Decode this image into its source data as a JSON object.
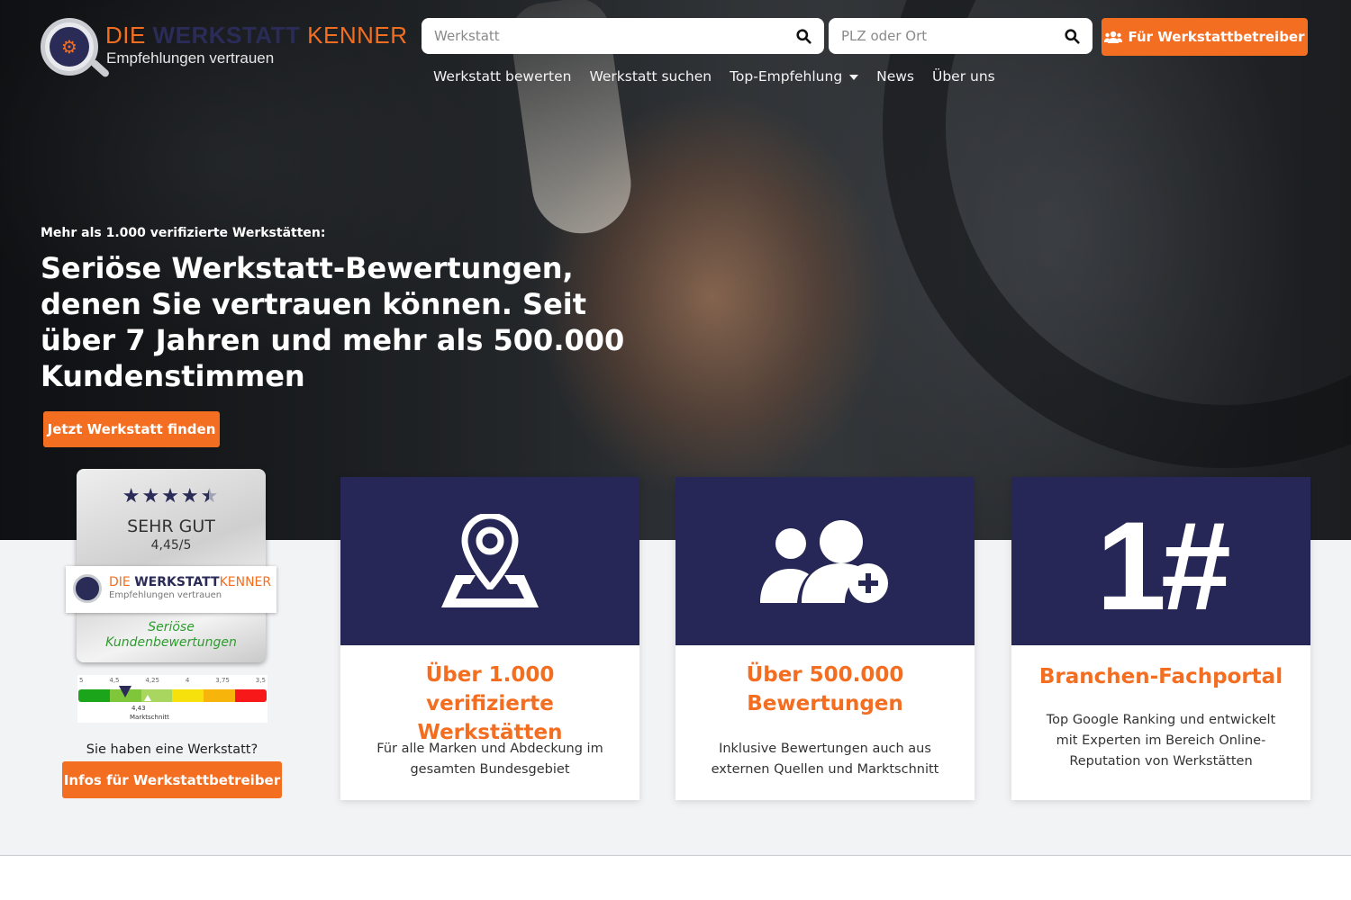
{
  "logo": {
    "brand_part1": "DIE",
    "brand_part2": "WERKSTATT",
    "brand_part3": "KENNER",
    "tagline": "Empfehlungen vertrauen"
  },
  "search": {
    "workshop_placeholder": "Werkstatt",
    "location_placeholder": "PLZ oder Ort"
  },
  "header": {
    "cta_label": "Für Werkstattbetreiber"
  },
  "nav": {
    "items": [
      {
        "label": "Werkstatt bewerten"
      },
      {
        "label": "Werkstatt suchen"
      },
      {
        "label": "Top-Empfehlung"
      },
      {
        "label": "News"
      },
      {
        "label": "Über uns"
      }
    ]
  },
  "hero": {
    "kicker": "Mehr als 1.000 verifizierte Werkstätten:",
    "title": "Seriöse Werkstatt-Bewertungen, denen Sie vertrauen können. Seit über 7 Jahren und mehr als 500.000 Kundenstimmen",
    "button_label": "Jetzt Werkstatt finden"
  },
  "badge": {
    "stars": "★★★★★",
    "rating_fraction": 0.89,
    "grade": "SEHR GUT",
    "score": "4,45/5",
    "brand_part1": "DIE",
    "brand_part2": "WERKSTATT",
    "brand_part3": "KENNER",
    "tagline": "Empfehlungen vertrauen",
    "claim_line1": "Seriöse",
    "claim_line2": "Kundenbewertungen"
  },
  "scale": {
    "ticks": [
      "5",
      "4,5",
      "4,25",
      "4",
      "3,75",
      "3,5"
    ],
    "value": "4,43",
    "label": "Marktschnitt",
    "colors": [
      "#1aa51a",
      "#7fc63a",
      "#a8d65e",
      "#f7e10c",
      "#f7b50c",
      "#f7181a"
    ]
  },
  "owner": {
    "question": "Sie haben eine Werkstatt?",
    "button_label": "Infos für Werkstattbetreiber"
  },
  "cards": [
    {
      "icon": "map-pin-icon",
      "title": "Über 1.000 verifizierte Werkstätten",
      "text": "Für alle Marken und Abdeckung im gesamten Bundesgebiet"
    },
    {
      "icon": "users-plus-icon",
      "title": "Über 500.000 Bewertungen",
      "text": "Inklusive Bewertungen auch aus externen Quellen und Marktschnitt"
    },
    {
      "icon": "rank-icon",
      "rank_text": "1#",
      "title": "Branchen-Fachportal",
      "text": "Top Google Ranking und entwickelt mit Experten im Bereich Online-Reputation von Werkstätten"
    }
  ],
  "colors": {
    "accent": "#f36e21",
    "navy": "#262756",
    "green_text": "#2e9b2e"
  }
}
